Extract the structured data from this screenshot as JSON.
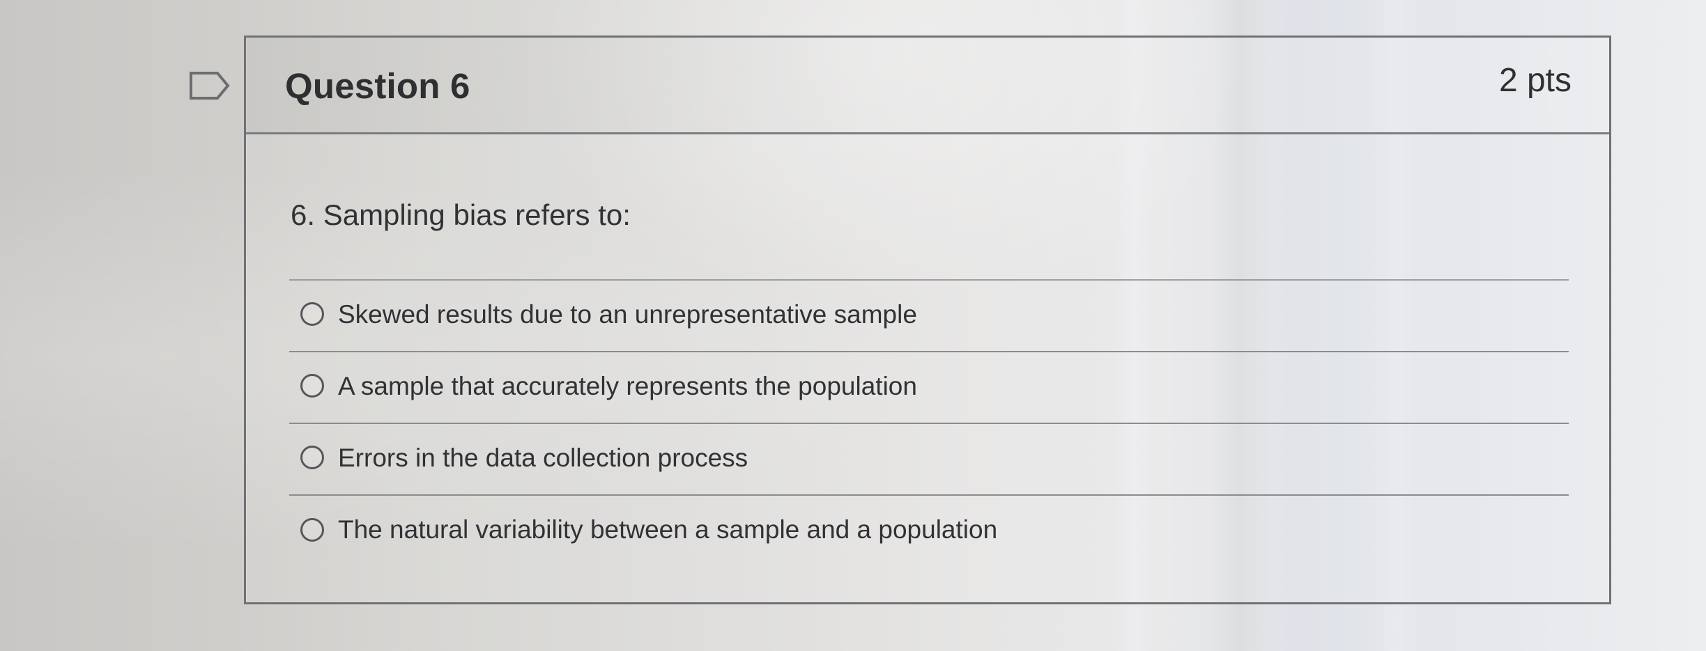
{
  "question": {
    "title": "Question 6",
    "points": "2 pts",
    "prompt": "6. Sampling bias refers to:",
    "flag_icon": "flag-icon"
  },
  "answers": [
    {
      "label": "Skewed results due to an unrepresentative sample",
      "selected": false
    },
    {
      "label": "A sample that accurately represents the population",
      "selected": false
    },
    {
      "label": "Errors in the data collection process",
      "selected": false
    },
    {
      "label": "The natural variability between a sample and a population",
      "selected": false
    }
  ],
  "colors": {
    "border": "#6f7174",
    "text": "#303235",
    "radio": "#55575a"
  }
}
